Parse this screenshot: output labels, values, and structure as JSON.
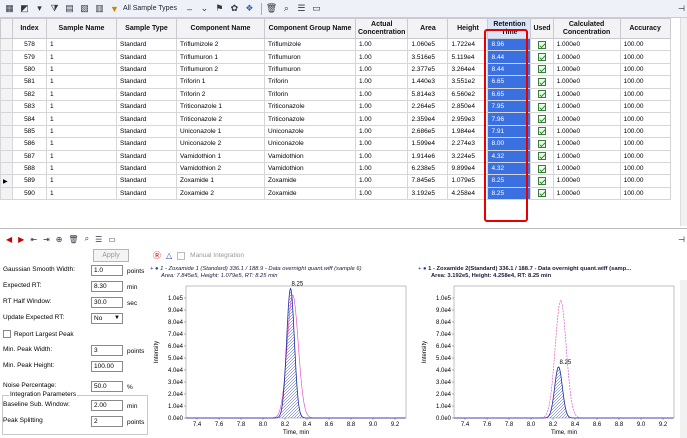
{
  "toolbar": {
    "sample_types_label": "All Sample Types"
  },
  "table": {
    "headers": [
      "Index",
      "Sample Name",
      "Sample Type",
      "Component Name",
      "Component Group Name",
      "Actual Concentration",
      "Area",
      "Height",
      "Retention Time",
      "Used",
      "Calculated Concentration",
      "Accuracy"
    ],
    "rows": [
      {
        "index": "578",
        "sample": "1",
        "type": "Standard",
        "comp": "Triflumizole 2",
        "group": "Triflumizole",
        "conc": "1.00",
        "area": "1.060e5",
        "height": "1.722e4",
        "rt": "8.96",
        "calc": "1.000e0",
        "acc": "100.00"
      },
      {
        "index": "579",
        "sample": "1",
        "type": "Standard",
        "comp": "Triflumuron 1",
        "group": "Triflumuron",
        "conc": "1.00",
        "area": "3.516e5",
        "height": "5.119e4",
        "rt": "8.44",
        "calc": "1.000e0",
        "acc": "100.00"
      },
      {
        "index": "580",
        "sample": "1",
        "type": "Standard",
        "comp": "Triflumuron 2",
        "group": "Triflumuron",
        "conc": "1.00",
        "area": "2.377e5",
        "height": "3.264e4",
        "rt": "8.44",
        "calc": "1.000e0",
        "acc": "100.00"
      },
      {
        "index": "581",
        "sample": "1",
        "type": "Standard",
        "comp": "Triforin 1",
        "group": "Triforin",
        "conc": "1.00",
        "area": "1.440e3",
        "height": "3.551e2",
        "rt": "6.65",
        "calc": "1.000e0",
        "acc": "100.00"
      },
      {
        "index": "582",
        "sample": "1",
        "type": "Standard",
        "comp": "Triforin 2",
        "group": "Triforin",
        "conc": "1.00",
        "area": "5.814e3",
        "height": "6.560e2",
        "rt": "6.65",
        "calc": "1.000e0",
        "acc": "100.00"
      },
      {
        "index": "583",
        "sample": "1",
        "type": "Standard",
        "comp": "Triticonazole 1",
        "group": "Triticonazole",
        "conc": "1.00",
        "area": "2.264e5",
        "height": "2.850e4",
        "rt": "7.95",
        "calc": "1.000e0",
        "acc": "100.00"
      },
      {
        "index": "584",
        "sample": "1",
        "type": "Standard",
        "comp": "Triticonazole 2",
        "group": "Triticonazole",
        "conc": "1.00",
        "area": "2.359e4",
        "height": "2.959e3",
        "rt": "7.96",
        "calc": "1.000e0",
        "acc": "100.00"
      },
      {
        "index": "585",
        "sample": "1",
        "type": "Standard",
        "comp": "Uniconazole 1",
        "group": "Uniconazole",
        "conc": "1.00",
        "area": "2.686e5",
        "height": "1.984e4",
        "rt": "7.91",
        "calc": "1.000e0",
        "acc": "100.00"
      },
      {
        "index": "586",
        "sample": "1",
        "type": "Standard",
        "comp": "Uniconazole 2",
        "group": "Uniconazole",
        "conc": "1.00",
        "area": "1.599e4",
        "height": "2.274e3",
        "rt": "8.00",
        "calc": "1.000e0",
        "acc": "100.00"
      },
      {
        "index": "587",
        "sample": "1",
        "type": "Standard",
        "comp": "Vamidothion 1",
        "group": "Vamidothion",
        "conc": "1.00",
        "area": "1.914e6",
        "height": "3.224e5",
        "rt": "4.32",
        "calc": "1.000e0",
        "acc": "100.00"
      },
      {
        "index": "588",
        "sample": "1",
        "type": "Standard",
        "comp": "Vamidothion 2",
        "group": "Vamidothion",
        "conc": "1.00",
        "area": "6.238e5",
        "height": "9.899e4",
        "rt": "4.32",
        "calc": "1.000e0",
        "acc": "100.00"
      },
      {
        "index": "589",
        "sample": "1",
        "type": "Standard",
        "comp": "Zoxamide 1",
        "group": "Zoxamide",
        "conc": "1.00",
        "area": "7.845e5",
        "height": "1.079e5",
        "rt": "8.25",
        "calc": "1.000e0",
        "acc": "100.00"
      },
      {
        "index": "590",
        "sample": "1",
        "type": "Standard",
        "comp": "Zoxamide 2",
        "group": "Zoxamide",
        "conc": "1.00",
        "area": "3.192e5",
        "height": "4.258e4",
        "rt": "8.25",
        "calc": "1.000e0",
        "acc": "100.00"
      }
    ]
  },
  "integration": {
    "apply_label": "Apply",
    "manual_label": "Manual Integration",
    "gaussian_label": "Gaussian Smooth Width:",
    "gaussian_value": "1.0",
    "gaussian_unit": "points",
    "expected_rt_label": "Expected RT:",
    "expected_rt_value": "8.30",
    "expected_rt_unit": "min",
    "rt_half_label": "RT Half Window:",
    "rt_half_value": "30.0",
    "rt_half_unit": "sec",
    "update_rt_label": "Update Expected RT:",
    "update_rt_value": "No",
    "report_largest_label": "Report Largest Peak",
    "min_width_label": "Min. Peak Width:",
    "min_width_value": "3",
    "min_width_unit": "points",
    "min_height_label": "Min. Peak Height:",
    "min_height_value": "100.00",
    "group_label": "Integration Parameters",
    "noise_label": "Noise Percentage:",
    "noise_value": "50.0",
    "noise_unit": "%",
    "baseline_label": "Baseline Sub. Window:",
    "baseline_value": "2.00",
    "baseline_unit": "min",
    "splitting_label": "Peak Splitting",
    "splitting_value": "2",
    "splitting_unit": "points"
  },
  "chart_data": [
    {
      "type": "line",
      "title": "1 - Zoxamide 1 (Standard) 336.1 / 188.9 - Data overnight quant.wiff (sample 6)",
      "subtitle": "Area: 7.845e5, Height: 1.079e5, RT: 8.25 min",
      "xlabel": "Time, min",
      "ylabel": "Intensity",
      "xlim": [
        7.3,
        9.3
      ],
      "ylim": [
        0,
        110000
      ],
      "yticks": [
        "0.0e0",
        "1.0e4",
        "2.0e4",
        "3.0e4",
        "4.0e4",
        "5.0e4",
        "6.0e4",
        "7.0e4",
        "8.0e4",
        "9.0e4",
        "1.0e5"
      ],
      "xticks": [
        "7.4",
        "7.6",
        "7.8",
        "8.0",
        "8.2",
        "8.4",
        "8.6",
        "8.8",
        "9.0",
        "9.2"
      ],
      "peak_label": "8.25",
      "peak_rt": 8.25,
      "peak_height": 107900,
      "peak_sigma": 0.035
    },
    {
      "type": "line",
      "title": "1 - Zoxamide 2(Standard) 336.1 / 188.7 - Data overnight quant.wiff (samp...",
      "subtitle": "Area: 3.192e5, Height: 4.258e4, RT: 8.25 min",
      "xlabel": "Time, min",
      "ylabel": "Intensity",
      "xlim": [
        7.3,
        9.3
      ],
      "ylim": [
        0,
        110000
      ],
      "yticks": [
        "0.0e0",
        "1.0e4",
        "2.0e4",
        "3.0e4",
        "4.0e4",
        "5.0e4",
        "6.0e4",
        "7.0e4",
        "8.0e4",
        "9.0e4",
        "1.0e5"
      ],
      "xticks": [
        "7.4",
        "7.6",
        "7.8",
        "8.0",
        "8.2",
        "8.4",
        "8.6",
        "8.8",
        "9.0",
        "9.2"
      ],
      "peak_label": "8.25",
      "peak_rt": 8.25,
      "peak_height": 42580,
      "peak_sigma": 0.035
    }
  ]
}
